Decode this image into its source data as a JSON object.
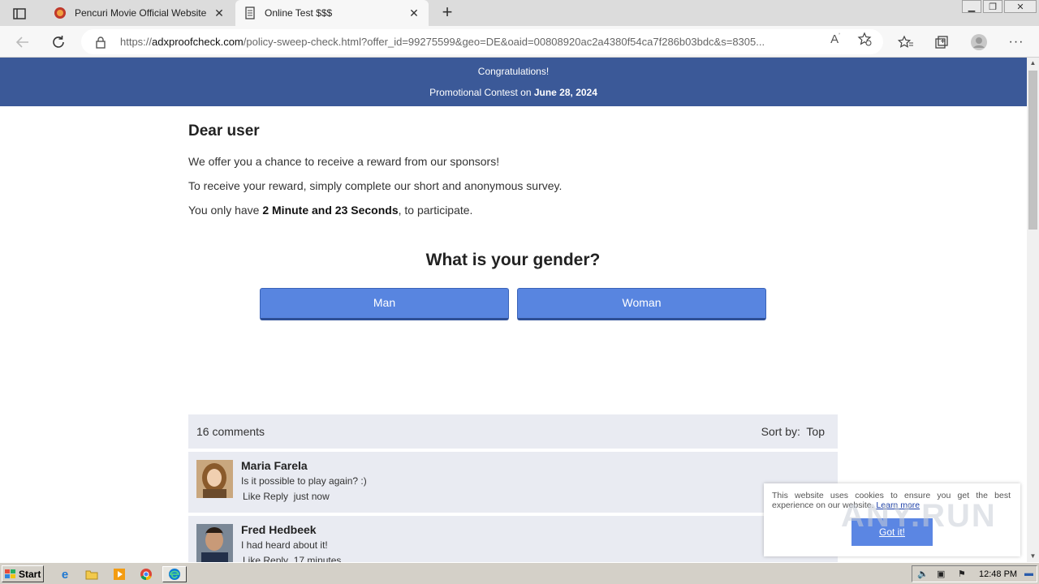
{
  "browser": {
    "tabs": [
      {
        "title": "Pencuri Movie Official Website",
        "active": false
      },
      {
        "title": "Online Test $$$",
        "active": true
      }
    ],
    "address": {
      "url_prefix": "https://",
      "url_domain": "adxproofcheck.com",
      "url_rest": "/policy-sweep-check.html?offer_id=99275599&geo=DE&oaid=00808920ac2a4380f54ca7f286b03bdc&s=8305..."
    }
  },
  "page": {
    "banner": {
      "line1": "Congratulations!",
      "line2_prefix": "Promotional Contest on ",
      "line2_date": "June 28, 2024"
    },
    "greeting": "Dear user",
    "p1": "We offer you a chance to receive a reward from our sponsors!",
    "p2": "To receive your reward, simply complete our short and anonymous survey.",
    "p3_prefix": "You only have ",
    "p3_time": "2 Minute and 23 Seconds",
    "p3_suffix": ", to participate.",
    "question": "What is your gender?",
    "answers": [
      "Man",
      "Woman"
    ],
    "comments": {
      "count_label": "16 comments",
      "sort_label": "Sort by:",
      "sort_value": "Top",
      "items": [
        {
          "name": "Maria Farela",
          "text": "Is it possible to play again? :)",
          "like": "Like",
          "reply": "Reply",
          "time": "just now"
        },
        {
          "name": "Fred Hedbeek",
          "text": "I had heard about it!",
          "like": "Like",
          "reply": "Reply",
          "time": "17 minutes"
        }
      ]
    },
    "cookie": {
      "message": "This website uses cookies to ensure you get the best experience on our website.",
      "learn_more": "Learn more",
      "button": "Got it!"
    },
    "watermark": "ANY.RUN"
  },
  "taskbar": {
    "start_label": "Start",
    "clock": "12:48 PM"
  },
  "colors": {
    "banner_bg": "#3b5998",
    "button_bg": "#5885e0",
    "comment_bg": "#e9ebf2"
  }
}
